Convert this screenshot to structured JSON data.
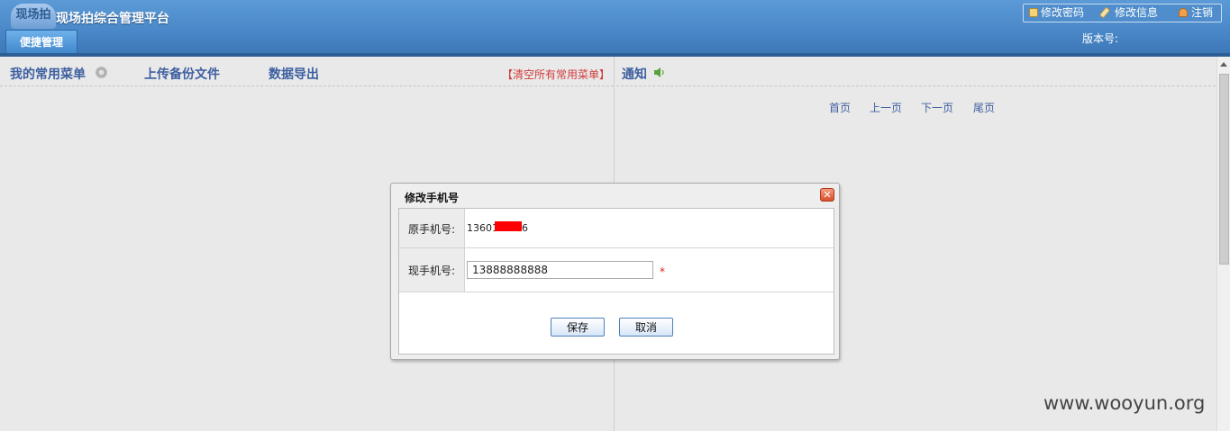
{
  "header": {
    "logo_mark": "现场拍",
    "app_title": "现场拍综合管理平台",
    "tab_label": "便捷管理",
    "version_label": "版本号:",
    "user_menu": {
      "change_password": "修改密码",
      "change_info": "修改信息",
      "logout": "注销"
    }
  },
  "left_panel": {
    "my_menu": "我的常用菜单",
    "upload_backup": "上传备份文件",
    "data_export": "数据导出",
    "clear_menus": "【清空所有常用菜单】"
  },
  "right_panel": {
    "notice_title": "通知",
    "pager": {
      "first": "首页",
      "prev": "上一页",
      "next": "下一页",
      "last": "尾页"
    }
  },
  "dialog": {
    "title": "修改手机号",
    "close_icon": "close-icon",
    "original_label": "原手机号:",
    "original_value_prefix": "13601",
    "original_value_suffix": "6",
    "new_label": "现手机号:",
    "new_value": "13888888888",
    "required_mark": "*",
    "save_label": "保存",
    "cancel_label": "取消"
  },
  "watermark": "www.wooyun.org",
  "colors": {
    "header_blue": "#4a88c9",
    "link_blue": "#3d5fa0",
    "clear_red": "#d23b3b",
    "redaction": "#ff0000"
  }
}
